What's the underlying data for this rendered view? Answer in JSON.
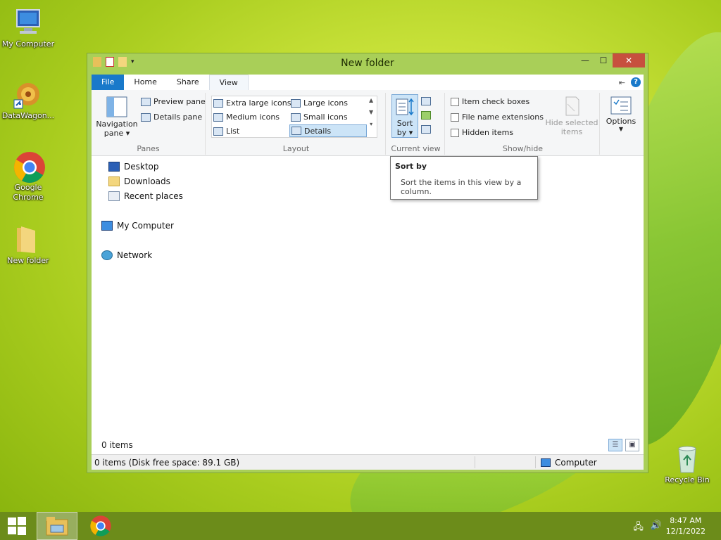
{
  "desktop": {
    "icons": [
      {
        "label": "My Computer"
      },
      {
        "label": "DataWagon..."
      },
      {
        "label": "Google Chrome"
      },
      {
        "label": "New folder"
      },
      {
        "label": "Recycle Bin"
      }
    ]
  },
  "window": {
    "title": "New folder",
    "controls": {
      "minimize": "—",
      "maximize": "☐",
      "close": "✕"
    },
    "tabs": [
      {
        "label": "File"
      },
      {
        "label": "Home"
      },
      {
        "label": "Share"
      },
      {
        "label": "View"
      }
    ],
    "help": "?",
    "ribbon": {
      "panes": {
        "navigation_pane": "Navigation",
        "navigation_pane_2": "pane ▾",
        "preview_pane": "Preview pane",
        "details_pane": "Details pane",
        "label": "Panes"
      },
      "layout": {
        "items": [
          "Extra large icons",
          "Large icons",
          "Medium icons",
          "Small icons",
          "List",
          "Details"
        ],
        "label": "Layout"
      },
      "current_view": {
        "sort_by": "Sort",
        "sort_by_2": "by ▾",
        "label": "Current view"
      },
      "show_hide": {
        "item_check_boxes": "Item check boxes",
        "file_name_extensions": "File name extensions",
        "hidden_items": "Hidden items",
        "hide_selected": "Hide selected",
        "hide_selected_2": "items",
        "label": "Show/hide"
      },
      "options": "Options"
    },
    "nav": {
      "items": [
        {
          "label": "Desktop"
        },
        {
          "label": "Downloads"
        },
        {
          "label": "Recent places"
        },
        {
          "label": "My Computer"
        },
        {
          "label": "Network"
        }
      ]
    },
    "content_status": "0 items",
    "statusbar": {
      "left": "0 items (Disk free space: 89.1 GB)",
      "right": "Computer"
    },
    "tooltip": {
      "title": "Sort by",
      "body": "Sort the items in this view by a column."
    }
  },
  "taskbar": {
    "time": "8:47 AM",
    "date": "12/1/2022"
  },
  "colors": {
    "accent": "#1979ca",
    "window_frame": "#a9cf58",
    "taskbar": "#6c8c1a",
    "close": "#c7503e"
  }
}
